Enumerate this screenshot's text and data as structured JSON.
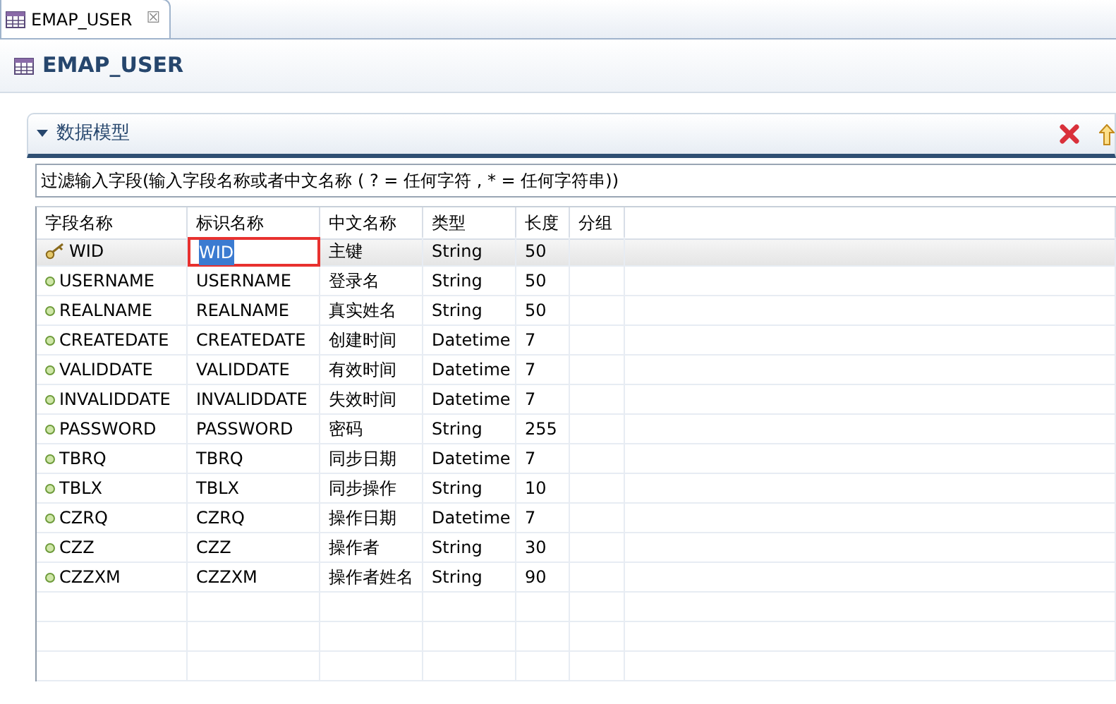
{
  "editor_tab": {
    "label": "EMAP_USER",
    "close": "☒",
    "selected": true
  },
  "title": "EMAP_USER",
  "section": {
    "title": "数据模型",
    "expanded": true
  },
  "filter": {
    "value": "过滤输入字段(输入字段名称或者中文名称 ( ? = 任何字符 , * = 任何字符串))"
  },
  "table": {
    "columns": [
      "字段名称",
      "标识名称",
      "中文名称",
      "类型",
      "长度",
      "分组"
    ],
    "rows": [
      {
        "kind": "key",
        "selected": true,
        "editing": true,
        "cells": [
          "WID",
          "WID",
          "主键",
          "String",
          "50",
          ""
        ]
      },
      {
        "kind": "field",
        "selected": false,
        "editing": false,
        "cells": [
          "USERNAME",
          "USERNAME",
          "登录名",
          "String",
          "50",
          ""
        ]
      },
      {
        "kind": "field",
        "selected": false,
        "editing": false,
        "cells": [
          "REALNAME",
          "REALNAME",
          "真实姓名",
          "String",
          "50",
          ""
        ]
      },
      {
        "kind": "field",
        "selected": false,
        "editing": false,
        "cells": [
          "CREATEDATE",
          "CREATEDATE",
          "创建时间",
          "Datetime",
          "7",
          ""
        ]
      },
      {
        "kind": "field",
        "selected": false,
        "editing": false,
        "cells": [
          "VALIDDATE",
          "VALIDDATE",
          "有效时间",
          "Datetime",
          "7",
          ""
        ]
      },
      {
        "kind": "field",
        "selected": false,
        "editing": false,
        "cells": [
          "INVALIDDATE",
          "INVALIDDATE",
          "失效时间",
          "Datetime",
          "7",
          ""
        ]
      },
      {
        "kind": "field",
        "selected": false,
        "editing": false,
        "cells": [
          "PASSWORD",
          "PASSWORD",
          "密码",
          "String",
          "255",
          ""
        ]
      },
      {
        "kind": "field",
        "selected": false,
        "editing": false,
        "cells": [
          "TBRQ",
          "TBRQ",
          "同步日期",
          "Datetime",
          "7",
          ""
        ]
      },
      {
        "kind": "field",
        "selected": false,
        "editing": false,
        "cells": [
          "TBLX",
          "TBLX",
          "同步操作",
          "String",
          "10",
          ""
        ]
      },
      {
        "kind": "field",
        "selected": false,
        "editing": false,
        "cells": [
          "CZRQ",
          "CZRQ",
          "操作日期",
          "Datetime",
          "7",
          ""
        ]
      },
      {
        "kind": "field",
        "selected": false,
        "editing": false,
        "cells": [
          "CZZ",
          "CZZ",
          "操作者",
          "String",
          "30",
          ""
        ]
      },
      {
        "kind": "field",
        "selected": false,
        "editing": false,
        "cells": [
          "CZZXM",
          "CZZXM",
          "操作者姓名",
          "String",
          "90",
          ""
        ]
      }
    ]
  }
}
